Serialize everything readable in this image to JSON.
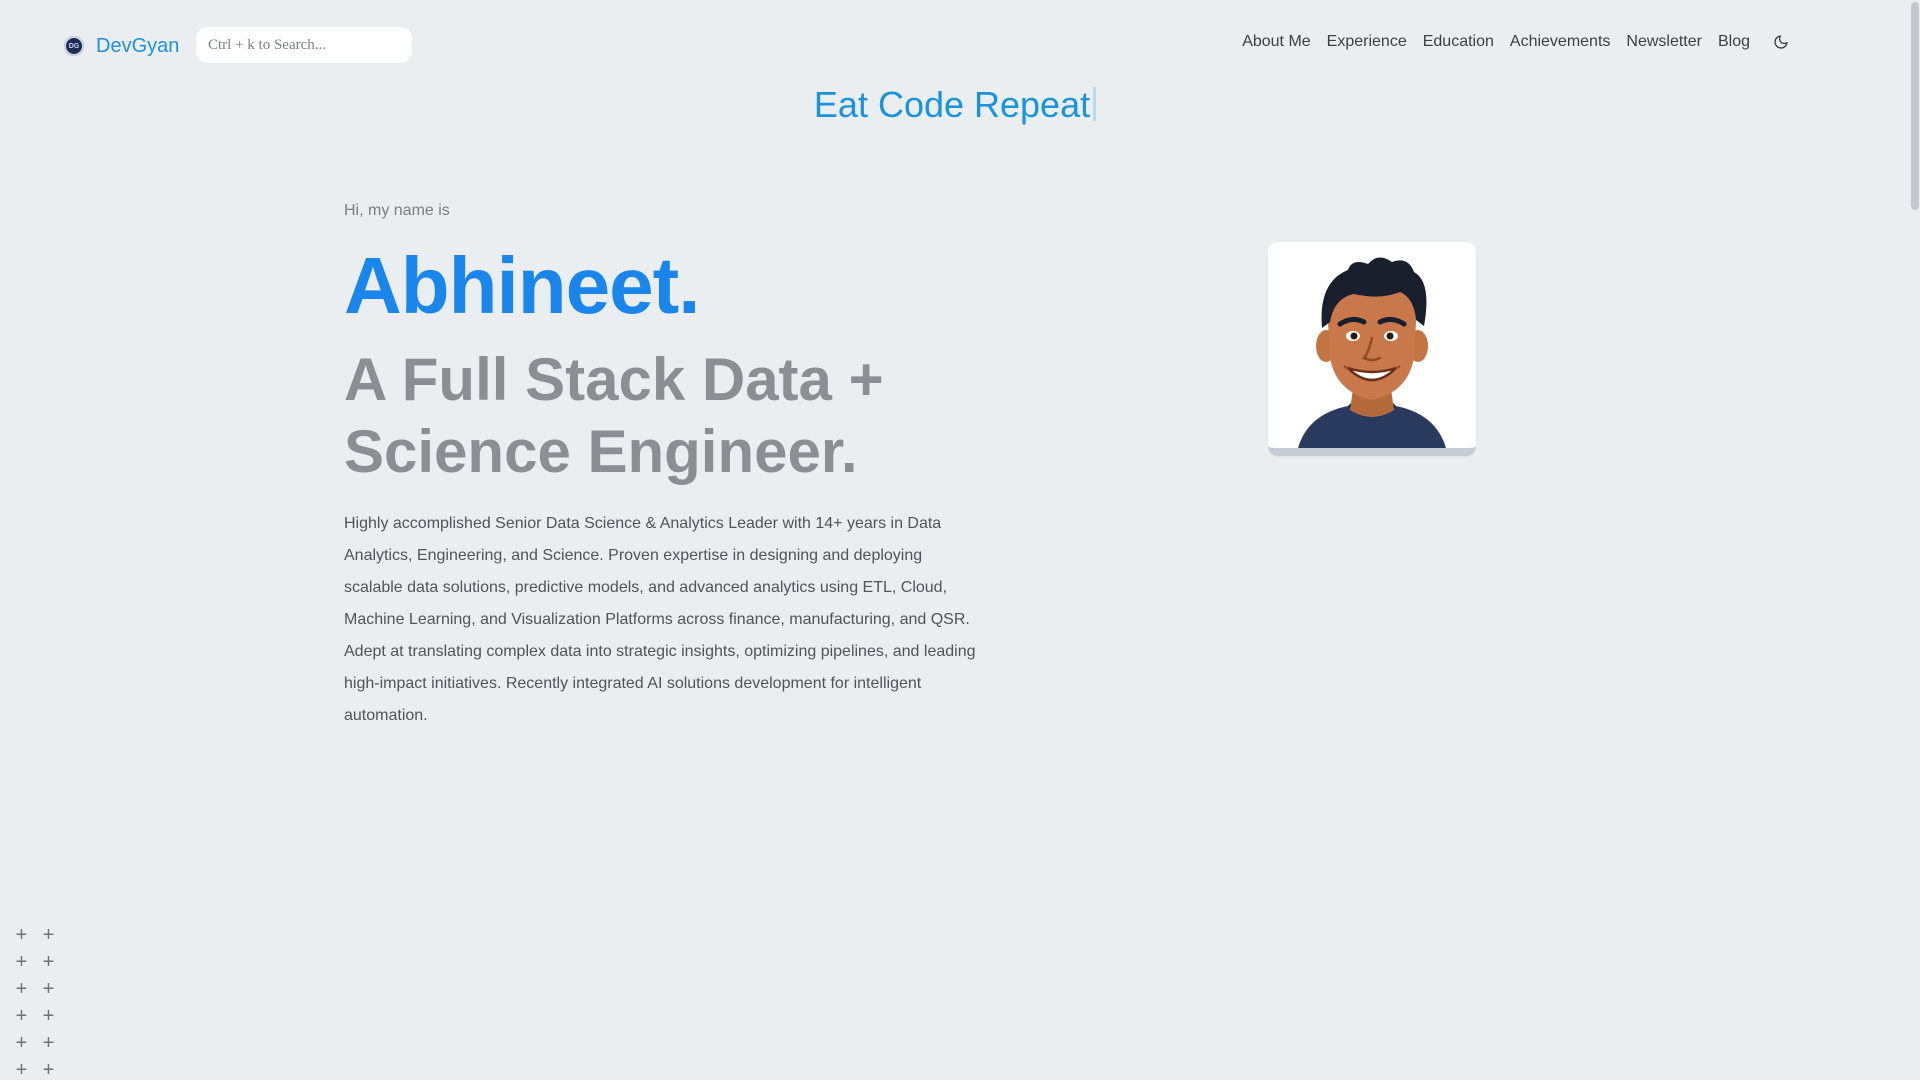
{
  "brand": {
    "logo_text": "DG",
    "name": "DevGyan"
  },
  "search": {
    "placeholder": "Ctrl + k to Search..."
  },
  "nav": {
    "items": [
      "About Me",
      "Experience",
      "Education",
      "Achievements",
      "Newsletter",
      "Blog"
    ],
    "theme_icon": "moon-icon"
  },
  "tagline": {
    "text": "Eat Code Repeat"
  },
  "hero": {
    "greeting": "Hi, my name is",
    "name": "Abhineet.",
    "role": "A Full Stack Data + Science Engineer.",
    "bio": "Highly accomplished Senior Data Science & Analytics Leader with 14+ years in Data Analytics, Engineering, and Science. Proven expertise in designing and deploying scalable data solutions, predictive models, and advanced analytics using ETL, Cloud, Machine Learning, and Visualization Platforms across finance, manufacturing, and QSR. Adept at translating complex data into strategic insights, optimizing pipelines, and leading high-impact initiatives. Recently integrated AI solutions development for intelligent automation."
  },
  "avatar": {
    "icon": "profile-avatar-illustration"
  },
  "decor": {
    "plus_symbol": "+"
  },
  "colors": {
    "background": "#ebeef1",
    "accent": "#1a86eb",
    "tagline": "#1a93de",
    "muted_heading": "#8b8e93"
  }
}
